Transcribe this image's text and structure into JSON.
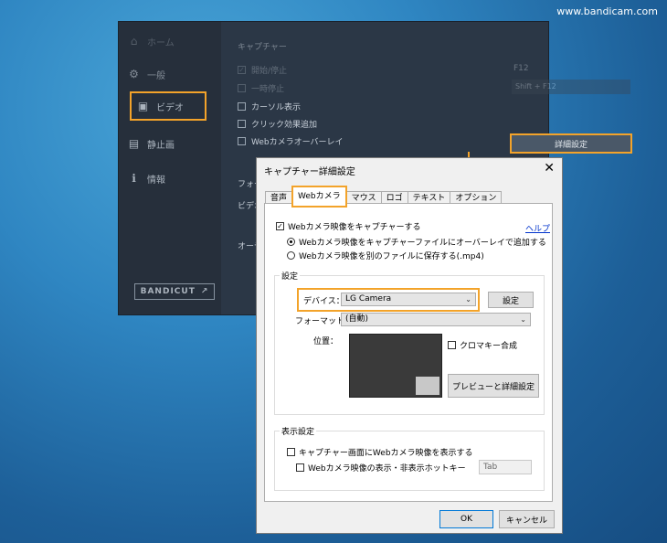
{
  "watermark": "www.bandicam.com",
  "app": {
    "sidebar": {
      "items": [
        {
          "label": "ホーム",
          "icon": "home-icon"
        },
        {
          "label": "一般",
          "icon": "gear-icon"
        },
        {
          "label": "ビデオ",
          "icon": "video-settings-icon"
        },
        {
          "label": "静止画",
          "icon": "image-icon"
        },
        {
          "label": "情報",
          "icon": "info-icon"
        }
      ],
      "bandicut": "BANDICUT"
    },
    "main": {
      "capture_title": "キャプチャー",
      "options": [
        {
          "label": "開始/停止",
          "checked": true,
          "hotkey": "F12"
        },
        {
          "label": "一時停止",
          "checked": false,
          "hotkey": "Shift + F12"
        },
        {
          "label": "カーソル表示",
          "checked": false
        },
        {
          "label": "クリック効果追加",
          "checked": false
        },
        {
          "label": "Webカメラオーバーレイ",
          "checked": false
        }
      ],
      "detail_button": "詳細設定",
      "format_label": "フォー",
      "video_label": "ビデオ",
      "audio_label": "オーデ"
    }
  },
  "dialog": {
    "title": "キャプチャー詳細設定",
    "close": "✕",
    "tabs": [
      "音声",
      "Webカメラ",
      "マウス",
      "ロゴ",
      "テキスト",
      "オプション"
    ],
    "active_tab": "Webカメラ",
    "capture_webcam": "Webカメラ映像をキャプチャーする",
    "help": "ヘルプ",
    "radio_overlay": "Webカメラ映像をキャプチャーファイルにオーバーレイで追加する",
    "radio_separate": "Webカメラ映像を別のファイルに保存する(.mp4)",
    "settings_group": "設定",
    "device_label": "デバイス：",
    "device_value": "LG Camera",
    "settings_button": "設定",
    "format_label": "フォーマット：",
    "format_value": "(自動)",
    "position_label": "位置：",
    "chroma_label": "クロマキー合成",
    "preview_button": "プレビューと詳細設定",
    "display_group": "表示設定",
    "show_on_screen": "キャプチャー画面にWebカメラ映像を表示する",
    "hotkey_label": "Webカメラ映像の表示・非表示ホットキー",
    "hotkey_value": "Tab",
    "ok": "OK",
    "cancel": "キャンセル"
  },
  "colors": {
    "accent": "#f3a32a",
    "app_bg": "#2b3746",
    "sidebar_bg": "#262f3b",
    "dialog_bg": "#f0f0f0",
    "link": "#0033cc"
  }
}
